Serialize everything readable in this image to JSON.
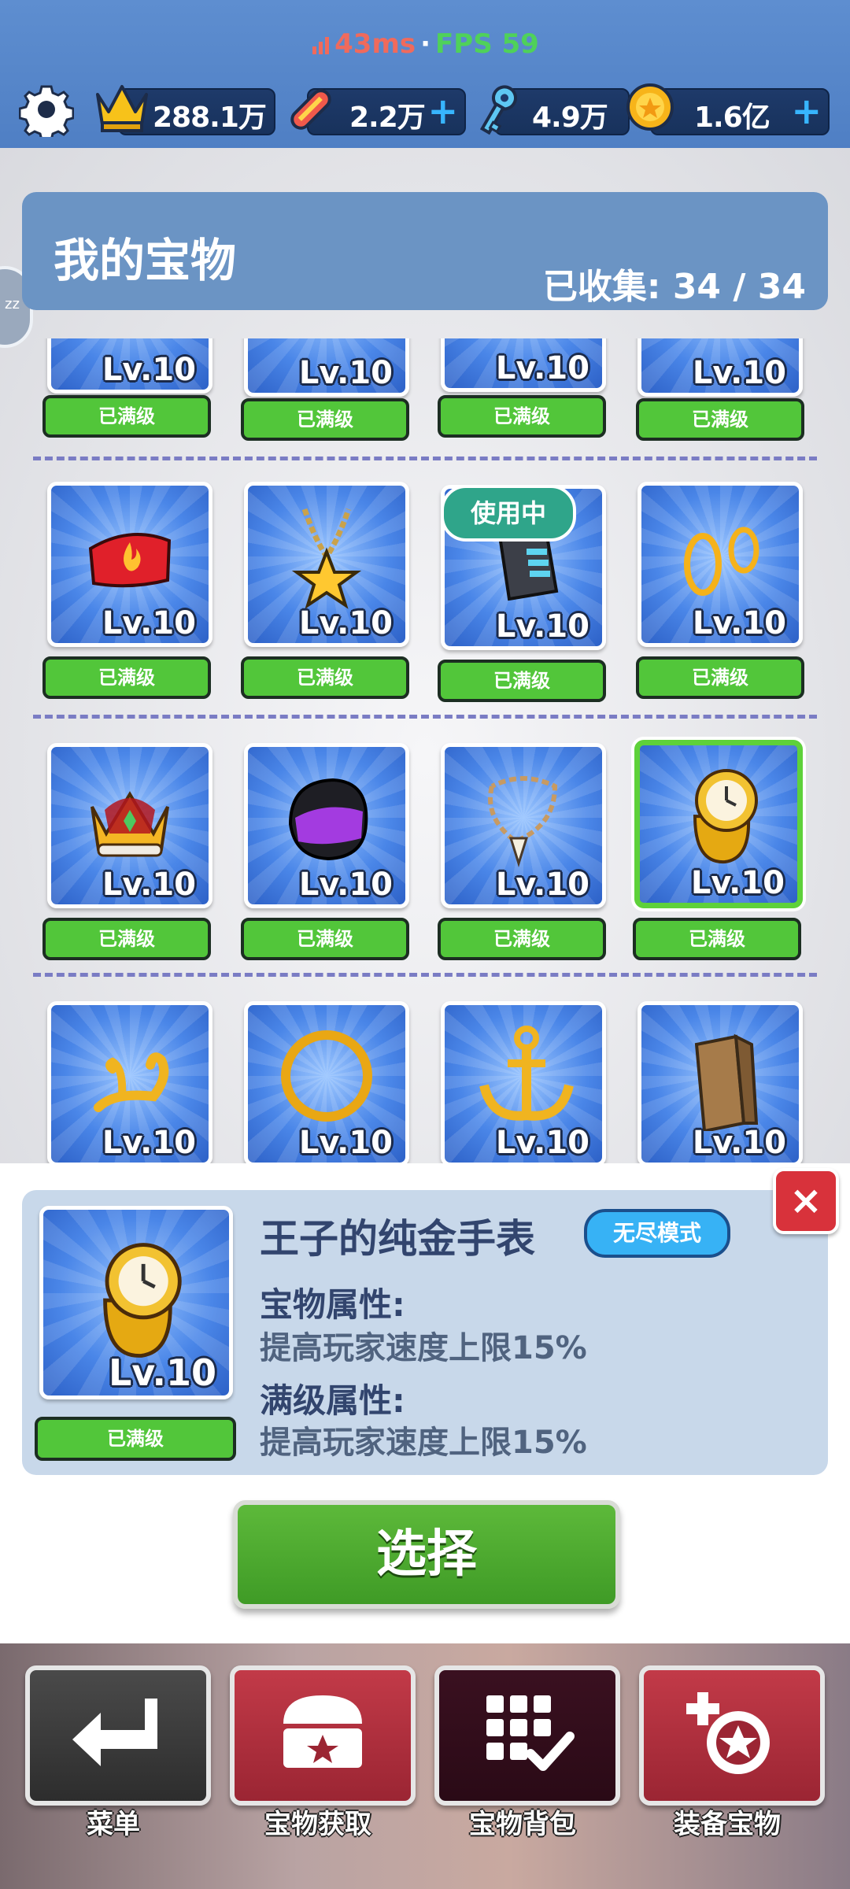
{
  "status": {
    "ping": "43ms",
    "separator": "·",
    "fps": "FPS 59"
  },
  "currency": {
    "crown": "288.1万",
    "board": "2.2万",
    "key": "4.9万",
    "coin": "1.6亿"
  },
  "header": {
    "title": "我的宝物",
    "collected": "已收集:  34 / 34"
  },
  "side_badge": "zz",
  "grid": {
    "level_label": "Lv.10",
    "max_label": "已满级",
    "in_use_label": "使用中"
  },
  "detail": {
    "name": "王子的纯金手表",
    "mode": "无尽模式",
    "attr_title": "宝物属性:",
    "attr_value": "提高玩家速度上限15%",
    "max_attr_title": "满级属性:",
    "max_attr_value": "提高玩家速度上限15%",
    "level": "Lv.10",
    "max_label": "已满级",
    "close": "×",
    "select": "选择"
  },
  "nav": {
    "menu": "菜单",
    "obtain": "宝物获取",
    "bag": "宝物背包",
    "equip": "装备宝物"
  },
  "colors": {
    "accent_green": "#52c63a",
    "close_red": "#d8323b",
    "header_blue": "#6b94c4",
    "in_use_teal": "#2fa58a"
  }
}
